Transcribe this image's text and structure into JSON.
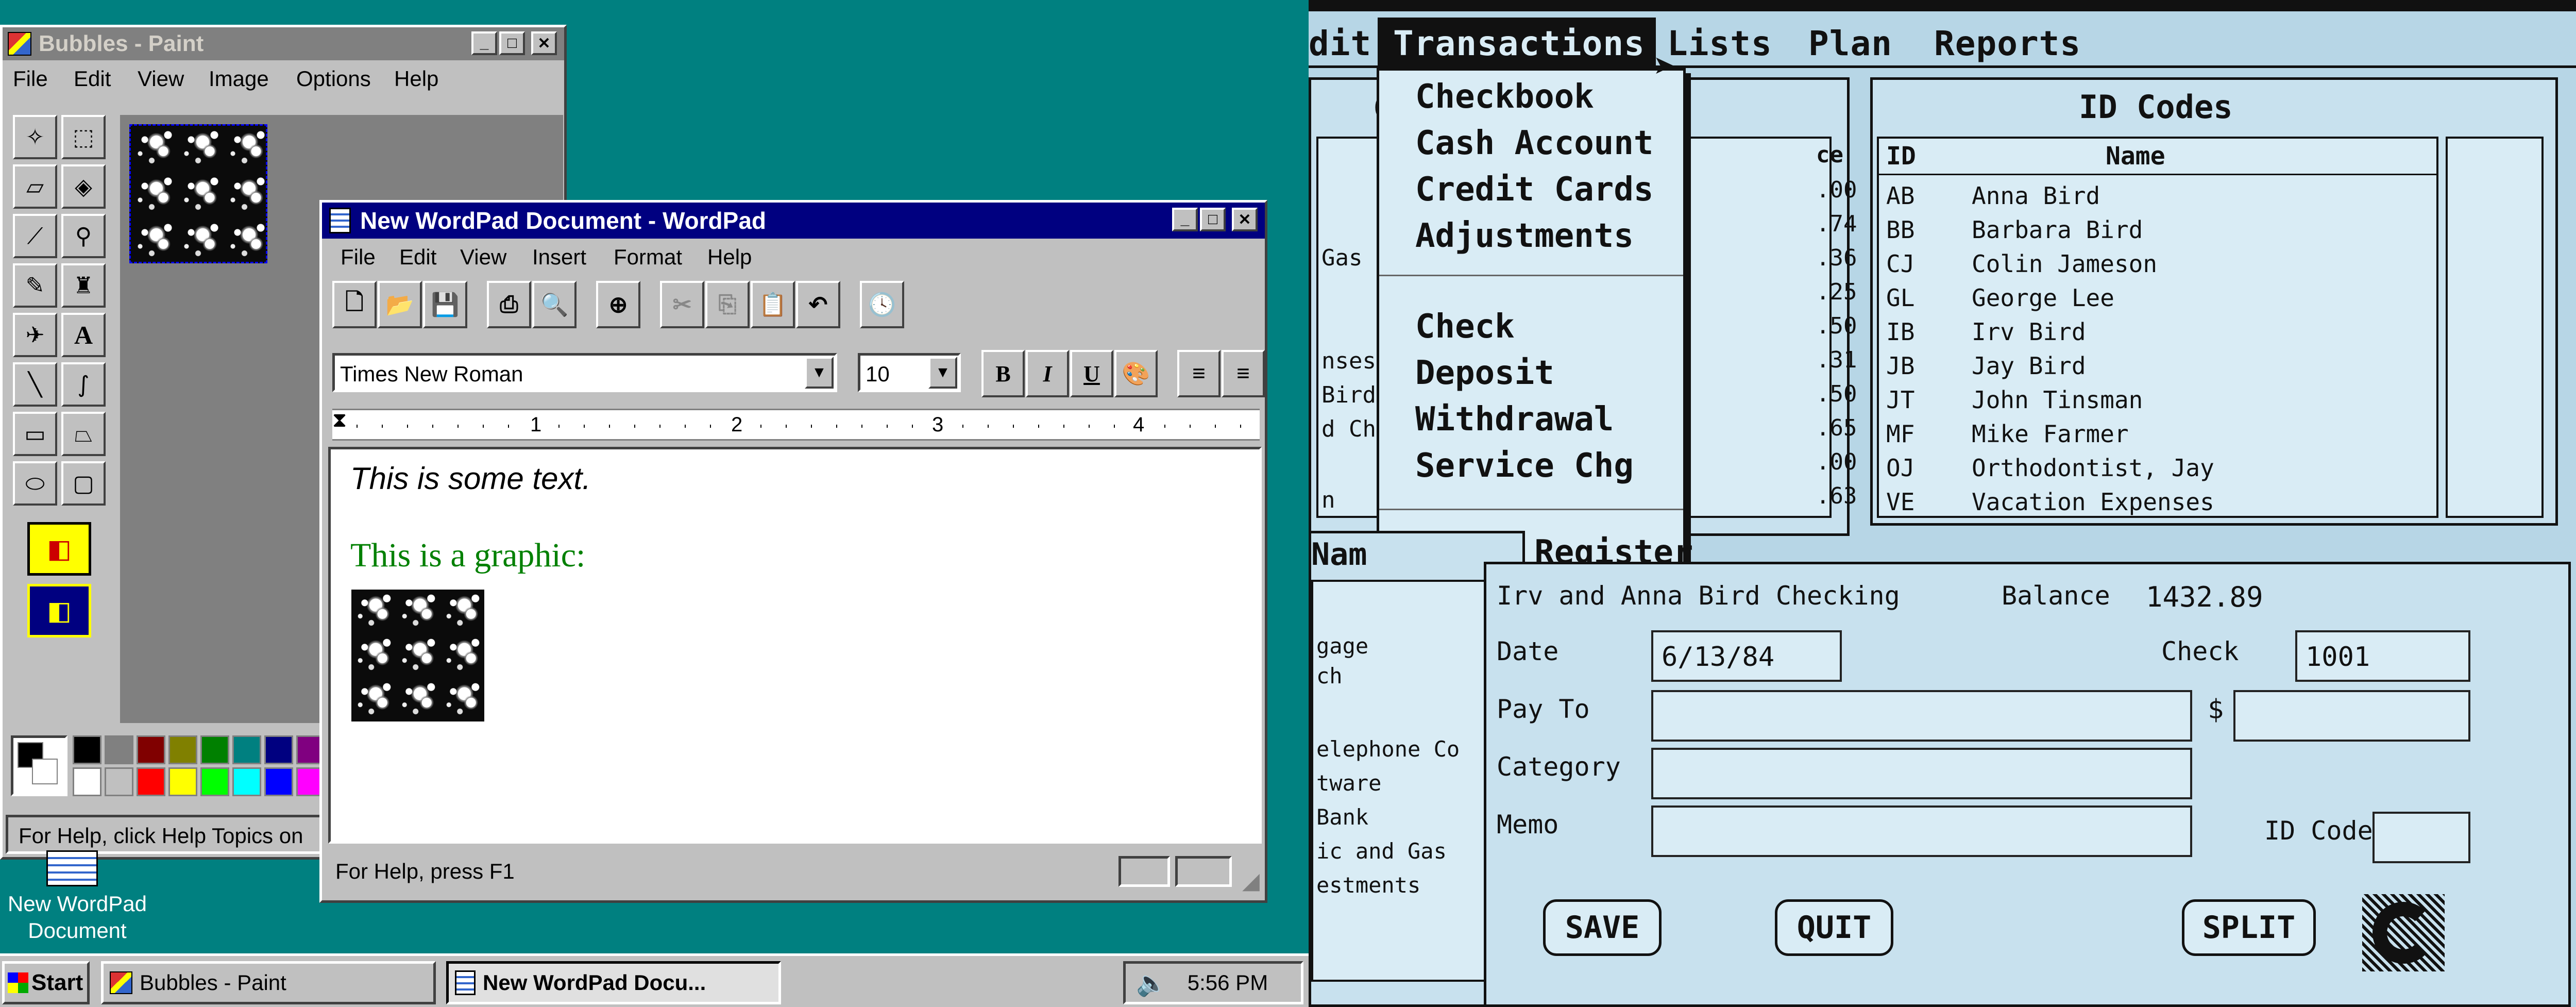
{
  "paint": {
    "title": "Bubbles - Paint",
    "menu": [
      "File",
      "Edit",
      "View",
      "Image",
      "Options",
      "Help"
    ],
    "status": "For Help, click Help Topics on"
  },
  "wordpad": {
    "title": "New WordPad Document - WordPad",
    "menu": [
      "File",
      "Edit",
      "View",
      "Insert",
      "Format",
      "Help"
    ],
    "font_name": "Times New Roman",
    "font_size": "10",
    "ruler_numbers": [
      "1",
      "2",
      "3",
      "4"
    ],
    "text_line1": "This is some text.",
    "text_line2": "This is a graphic:",
    "status": "For Help, press F1"
  },
  "desktop_icon": {
    "label_line1": "New WordPad",
    "label_line2": "Document"
  },
  "taskbar": {
    "start": "Start",
    "task1": "Bubbles - Paint",
    "task2": "New WordPad Docu...",
    "time": "5:56 PM"
  },
  "mac": {
    "menubar": [
      "dit",
      "Transactions",
      "Lists",
      "Plan",
      "Reports"
    ],
    "dropdown": [
      "Checkbook",
      "Cash Account",
      "Credit Cards",
      "Adjustments",
      "Check",
      "Deposit",
      "Withdrawal",
      "Service Chg",
      "Check Register"
    ],
    "left_panel_fragments": [
      "C",
      "ce",
      ".00",
      ".74",
      ".36",
      ".25",
      ".50",
      ".31",
      ".50",
      ".65",
      ".00",
      ".63",
      "Gas",
      "nses",
      "Bird",
      "d Che",
      "n"
    ],
    "id_codes": {
      "title": "ID Codes",
      "col_id": "ID",
      "col_name": "Name",
      "rows": [
        {
          "id": "AB",
          "name": "Anna Bird"
        },
        {
          "id": "BB",
          "name": "Barbara Bird"
        },
        {
          "id": "CJ",
          "name": "Colin Jameson"
        },
        {
          "id": "GL",
          "name": "George Lee"
        },
        {
          "id": "IB",
          "name": "Irv Bird"
        },
        {
          "id": "JB",
          "name": "Jay Bird"
        },
        {
          "id": "JT",
          "name": "John Tinsman"
        },
        {
          "id": "MF",
          "name": "Mike Farmer"
        },
        {
          "id": "OJ",
          "name": "Orthodontist, Jay"
        },
        {
          "id": "VE",
          "name": "Vacation Expenses"
        }
      ]
    },
    "lower_left": {
      "header": "Nam",
      "items": [
        "gage",
        "ch",
        "elephone Co",
        "tware",
        "Bank",
        "ic and Gas",
        "estments"
      ]
    },
    "form": {
      "account": "Irv and Anna Bird Checking",
      "balance_label": "Balance",
      "balance_value": "1432.89",
      "date_label": "Date",
      "date_value": "6/13/84",
      "check_label": "Check",
      "check_value": "1001",
      "payto_label": "Pay To",
      "dollar": "$",
      "category_label": "Category",
      "memo_label": "Memo",
      "idcode_label": "ID Code",
      "save": "SAVE",
      "quit": "QUIT",
      "split": "SPLIT"
    }
  }
}
